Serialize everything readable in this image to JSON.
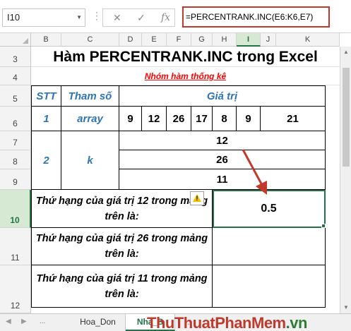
{
  "formula_bar": {
    "name_box": "I10",
    "formula": "=PERCENTRANK.INC(E6:K6,E7)",
    "cancel_glyph": "✕",
    "enter_glyph": "✓",
    "fx_glyph": "fx"
  },
  "columns": [
    "B",
    "C",
    "D",
    "E",
    "F",
    "G",
    "H",
    "I",
    "J",
    "K"
  ],
  "rows": [
    "3",
    "4",
    "5",
    "6",
    "7",
    "8",
    "9",
    "10",
    "11",
    "12"
  ],
  "sheet": {
    "title": "Hàm PERCENTRANK.INC trong Excel",
    "subtitle": "Nhóm hàm thống kê",
    "header_stt": "STT",
    "header_param": "Tham số",
    "header_value": "Giá trị",
    "row1_stt": "1",
    "row1_param": "array",
    "array_values": [
      "9",
      "12",
      "26",
      "17",
      "8",
      "9",
      "21"
    ],
    "row2_stt": "2",
    "row2_param": "k",
    "k_values": [
      "12",
      "26",
      "11"
    ],
    "q1": "Thứ hạng của giá trị 12 trong mảng trên là:",
    "q2": "Thứ hạng của giá trị 26 trong mảng trên là:",
    "q3": "Thứ hạng của giá trị 11 trong mảng trên là:",
    "result1": "0.5"
  },
  "tabs": {
    "items": [
      "Hoa_Don",
      "Nha_S"
    ],
    "active": "Nha_S",
    "more_glyph": "..."
  },
  "watermark": {
    "part1": "Thu",
    "part2": "ThuatPhanMem",
    "part3": ".vn"
  },
  "colors": {
    "accent": "#217346",
    "header_blue": "#2f75b5",
    "subtitle_red": "#ff0000",
    "arrow_red": "#c0392b"
  }
}
